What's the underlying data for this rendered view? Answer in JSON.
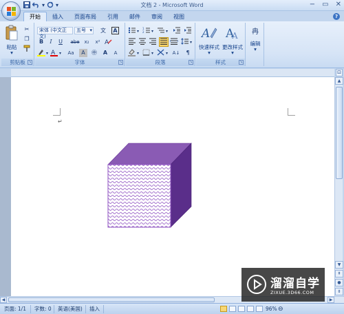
{
  "titlebar": {
    "title": "文档 2 - Microsoft Word",
    "qat_dropdown": "▾",
    "controls": [
      "−",
      "▭",
      "✕"
    ]
  },
  "tabs": [
    "开始",
    "插入",
    "页面布局",
    "引用",
    "邮件",
    "审阅",
    "视图"
  ],
  "active_tab": "开始",
  "ribbon": {
    "clipboard": {
      "label": "剪贴板",
      "paste_label": "粘贴"
    },
    "font": {
      "label": "字体",
      "font_name": "宋体 (中文正文)",
      "font_size": "五号",
      "buttons": {
        "bold": "B",
        "italic": "I",
        "underline": "U",
        "strike": "abe",
        "subscript": "x₂",
        "superscript": "x²",
        "clear": "A",
        "grow": "A",
        "shrink": "A",
        "case": "Aa",
        "pinyin": "文",
        "charborder": "A",
        "charshade": "A",
        "enclose": "㊥"
      }
    },
    "paragraph": {
      "label": "段落",
      "pilcrow": "¶",
      "sort": "A↓"
    },
    "styles": {
      "label": "样式",
      "quick_styles": "快速样式",
      "change_styles": "更改样式"
    },
    "editing": {
      "label": "编辑",
      "find_glyph": "冉"
    }
  },
  "document": {
    "paragraph_mark": "↵"
  },
  "statusbar": {
    "page": "页面: 1/1",
    "words": "字数: 0",
    "language": "英语(美国)",
    "mode": "插入",
    "zoom": "96%"
  },
  "watermark": {
    "main": "溜溜自学",
    "sub": "ZIXUE.3D66.COM"
  },
  "colors": {
    "cube_front": "#b18fce",
    "cube_top": "#8a5bb4",
    "cube_side": "#5a2e8a",
    "cube_pattern": "#8c4fc0",
    "ribbon_bg": "#dbe7f6"
  }
}
